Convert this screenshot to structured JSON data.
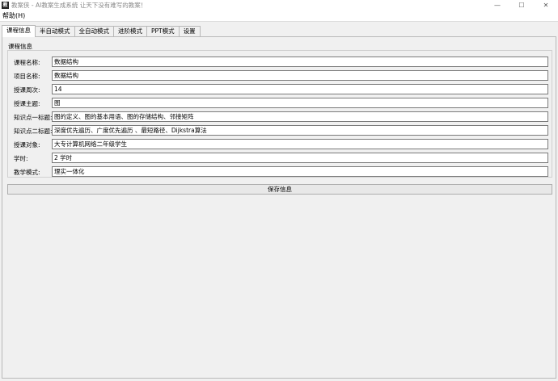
{
  "window": {
    "title": "教案侠 - AI教案生成系统   让天下没有难写的教案！",
    "icon_text": "教",
    "controls": {
      "minimize": "—",
      "maximize": "☐",
      "close": "✕"
    }
  },
  "menu": {
    "help": "帮助(H)"
  },
  "tabs": [
    {
      "label": "课程信息"
    },
    {
      "label": "半自动模式"
    },
    {
      "label": "全自动模式"
    },
    {
      "label": "进阶模式"
    },
    {
      "label": "PPT模式"
    },
    {
      "label": "设置"
    }
  ],
  "panel": {
    "group_title": "课程信息",
    "fields": [
      {
        "label": "课程名称:",
        "value": "数据结构"
      },
      {
        "label": "项目名称:",
        "value": "数据结构"
      },
      {
        "label": "授课周次:",
        "value": "14"
      },
      {
        "label": "授课主题:",
        "value": "图"
      },
      {
        "label": "知识点一标题:",
        "value": "图的定义、图的基本用语、图的存储结构、邻接矩阵"
      },
      {
        "label": "知识点二标题:",
        "value": "深度优先遍历、广度优先遍历 、最短路径、Dijkstra算法"
      },
      {
        "label": "授课对象:",
        "value": "大专计算机网络二年级学生"
      },
      {
        "label": "学时:",
        "value": "2 学时"
      },
      {
        "label": "教学模式:",
        "value": "理实一体化"
      }
    ],
    "save_label": "保存信息"
  }
}
